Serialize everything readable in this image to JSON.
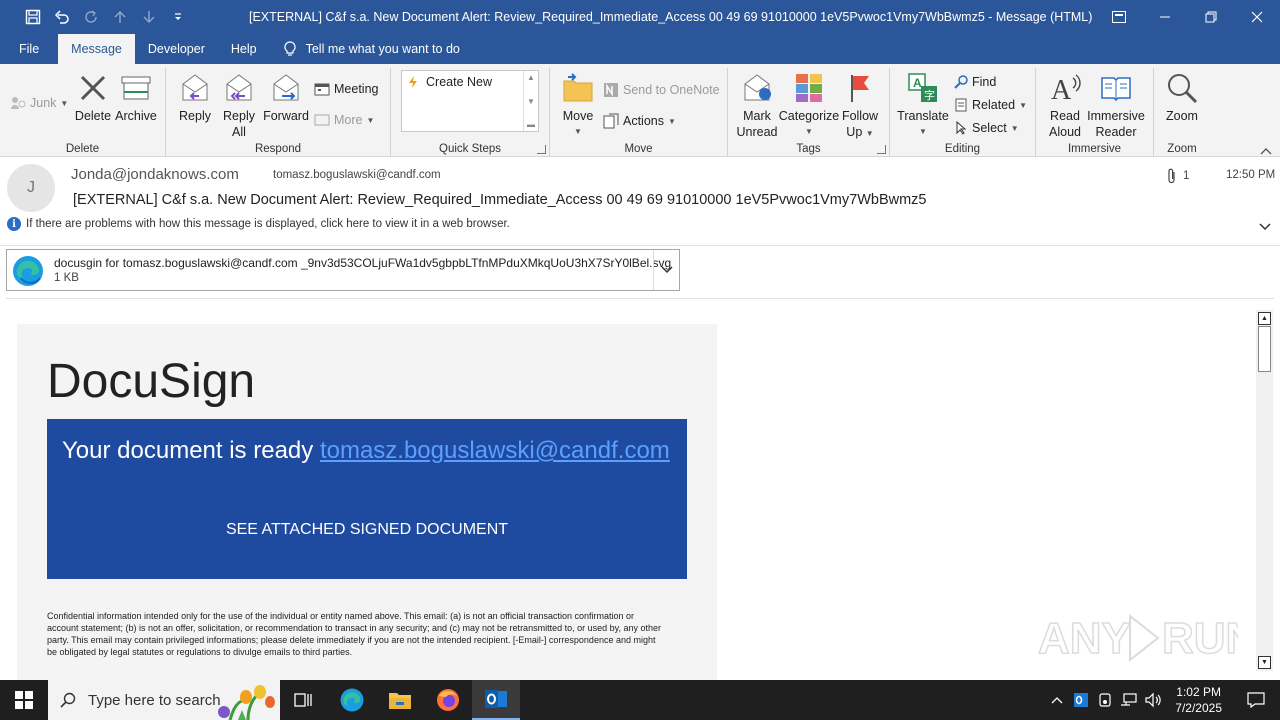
{
  "window": {
    "title": "[EXTERNAL] C&f s.a. New Document Alert: Review_Required_Immediate_Access 00 49 69 91010000  1eV5Pvwoc1Vmy7WbBwmz5  -  Message (HTML)"
  },
  "tabs": {
    "file": "File",
    "message": "Message",
    "developer": "Developer",
    "help": "Help",
    "tell_me": "Tell me what you want to do"
  },
  "ribbon": {
    "delete_group": {
      "label": "Delete",
      "junk": "Junk",
      "delete": "Delete",
      "archive": "Archive"
    },
    "respond_group": {
      "label": "Respond",
      "reply": "Reply",
      "reply_all_1": "Reply",
      "reply_all_2": "All",
      "forward": "Forward",
      "meeting": "Meeting",
      "more": "More"
    },
    "quicksteps_group": {
      "label": "Quick Steps",
      "create_new": "Create New"
    },
    "move_group": {
      "label": "Move",
      "move": "Move",
      "send_onenote": "Send to OneNote",
      "actions": "Actions"
    },
    "tags_group": {
      "label": "Tags",
      "mark_unread_1": "Mark",
      "mark_unread_2": "Unread",
      "categorize": "Categorize",
      "follow_up_1": "Follow",
      "follow_up_2": "Up"
    },
    "editing_group": {
      "label": "Editing",
      "translate": "Translate",
      "find": "Find",
      "related": "Related",
      "select": "Select"
    },
    "immersive_group": {
      "label": "Immersive",
      "read_aloud_1": "Read",
      "read_aloud_2": "Aloud",
      "immersive_reader_1": "Immersive",
      "immersive_reader_2": "Reader"
    },
    "zoom_group": {
      "label": "Zoom",
      "zoom": "Zoom"
    }
  },
  "message": {
    "avatar_initial": "J",
    "from": "Jonda@jondaknows.com",
    "to": "tomasz.boguslawski@candf.com",
    "subject": "[EXTERNAL] C&f s.a. New Document Alert: Review_Required_Immediate_Access 00 49 69 91010000  1eV5Pvwoc1Vmy7WbBwmz5",
    "attachment_count": "1",
    "time": "12:50 PM",
    "info_bar": "If there are problems with how this message is displayed, click here to view it in a web browser.",
    "attachment": {
      "name": "docusgin for tomasz.boguslawski@candf.com _9nv3d53COLjuFWa1dv5gbpbLTfnMPduXMkqUoU3hX7SrY0lBel.svg",
      "size": "1 KB"
    }
  },
  "email_body": {
    "logo": "DocuSign",
    "ready_text": "Your document is ready ",
    "ready_link": "tomasz.boguslawski@candf.com",
    "cta": "SEE ATTACHED SIGNED DOCUMENT",
    "legal": "Confidential information intended only for the use of  the individual or entity named above. This email: (a) is not an official transaction confirmation or account statement; (b) is not an offer, solicitation, or recommendation to transact in any security; and (c) may not be retransmitted to, or used by, any other party. This email may contain privileged informations; please delete immediately if you are not the intended recipient. [-Email-] correspondence and might be obligated by legal statutes or regulations to divulge emails to third parties."
  },
  "taskbar": {
    "search_placeholder": "Type here to search",
    "time": "1:02 PM",
    "date": "7/2/2025"
  },
  "colors": {
    "office_blue": "#2b579a",
    "docusign_banner": "#1e4aa0",
    "ribbon_bg": "#f3f3f3",
    "taskbar": "#1f1f1f"
  }
}
